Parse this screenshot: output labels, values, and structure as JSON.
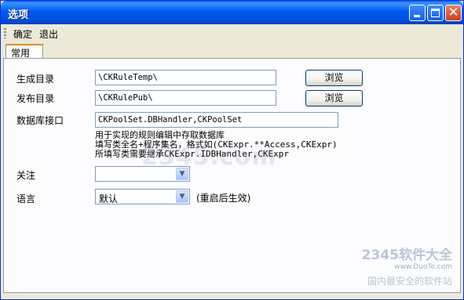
{
  "window": {
    "title": "选项"
  },
  "menu": {
    "ok": "确定",
    "exit": "退出"
  },
  "tabs": [
    {
      "label": "常用"
    }
  ],
  "form": {
    "generate_dir": {
      "label": "生成目录",
      "value": "\\CKRuleTemp\\",
      "browse": "浏览"
    },
    "publish_dir": {
      "label": "发布目录",
      "value": "\\CKRulePub\\",
      "browse": "浏览"
    },
    "db_interface": {
      "label": "数据库接口",
      "value": "CKPoolSet.DBHandler,CKPoolSet",
      "hint": [
        "用于实现的规则编辑中存取数据库",
        "填写类全名+程序集名，格式如(CKExpr.**Access,CKExpr)",
        "所填写类需要继承CKExpr.IDBHandler,CKExpr"
      ]
    },
    "focus": {
      "label": "关注",
      "value": ""
    },
    "language": {
      "label": "语言",
      "value": "默认",
      "note": "(重启后生效)"
    }
  },
  "watermark": {
    "brand": "2345软件大全",
    "url": "www.DuoTe.com",
    "slogan": "国内最安全的软件站",
    "overlay": "2345.com"
  }
}
